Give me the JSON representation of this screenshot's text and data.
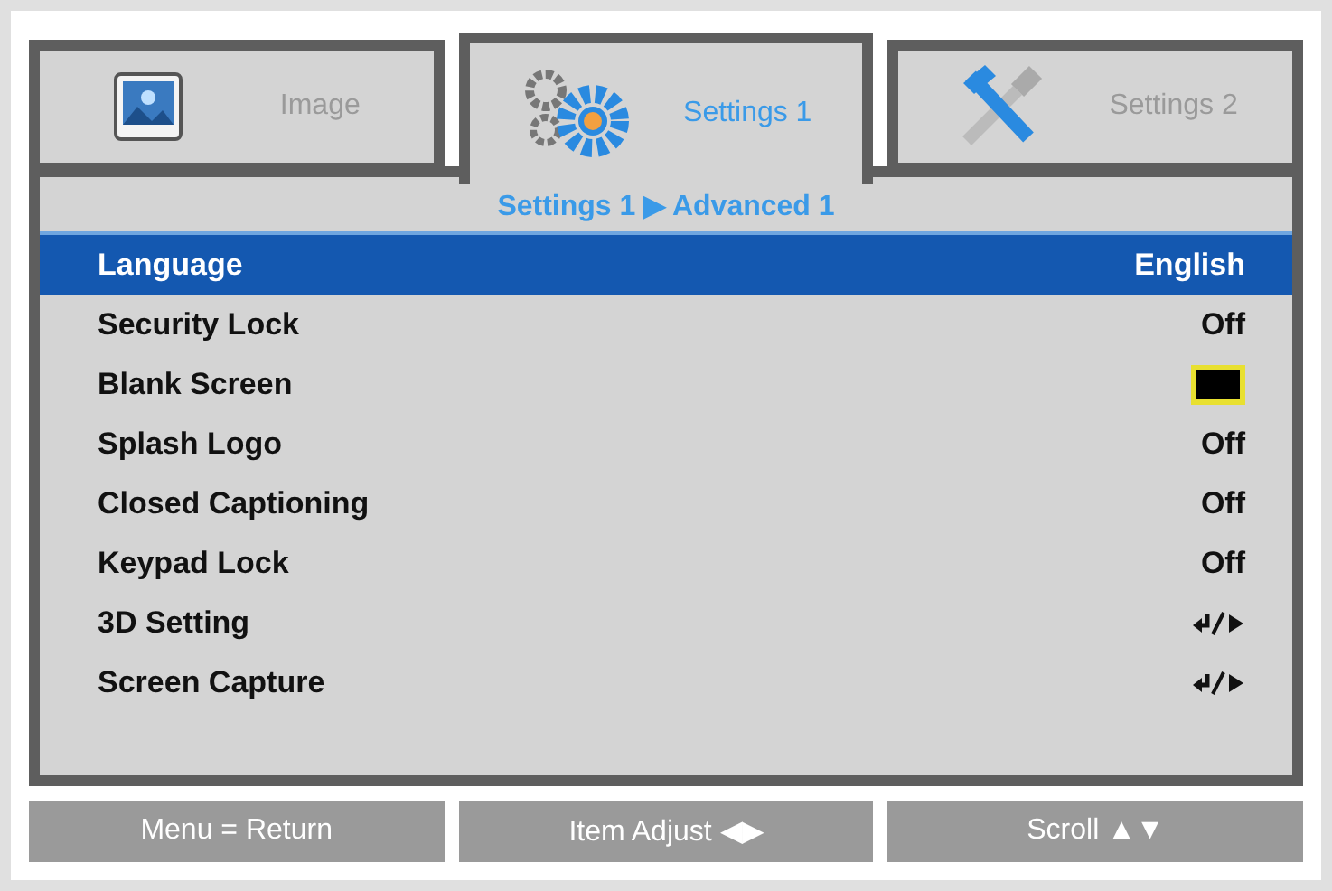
{
  "tabs": [
    {
      "label": "Image",
      "kind": "picture",
      "selected": false
    },
    {
      "label": "Settings 1",
      "kind": "gears",
      "selected": true
    },
    {
      "label": "Settings 2",
      "kind": "tools",
      "selected": false
    }
  ],
  "breadcrumb": "Settings 1 ▶ Advanced 1",
  "items": [
    {
      "label": "Language",
      "kind": "text",
      "value": "English",
      "selected": true
    },
    {
      "label": "Security Lock",
      "kind": "text",
      "value": "Off",
      "selected": false
    },
    {
      "label": "Blank Screen",
      "kind": "swatch",
      "selected": false
    },
    {
      "label": "Splash Logo",
      "kind": "text",
      "value": "Off",
      "selected": false
    },
    {
      "label": "Closed Captioning",
      "kind": "text",
      "value": "Off",
      "selected": false
    },
    {
      "label": "Keypad Lock",
      "kind": "text",
      "value": "Off",
      "selected": false
    },
    {
      "label": "3D Setting",
      "kind": "enter",
      "selected": false
    },
    {
      "label": "Screen Capture",
      "kind": "enter",
      "selected": false
    }
  ],
  "hints": [
    "Menu = Return",
    "Item Adjust ◀▶",
    "Scroll ▲▼"
  ]
}
